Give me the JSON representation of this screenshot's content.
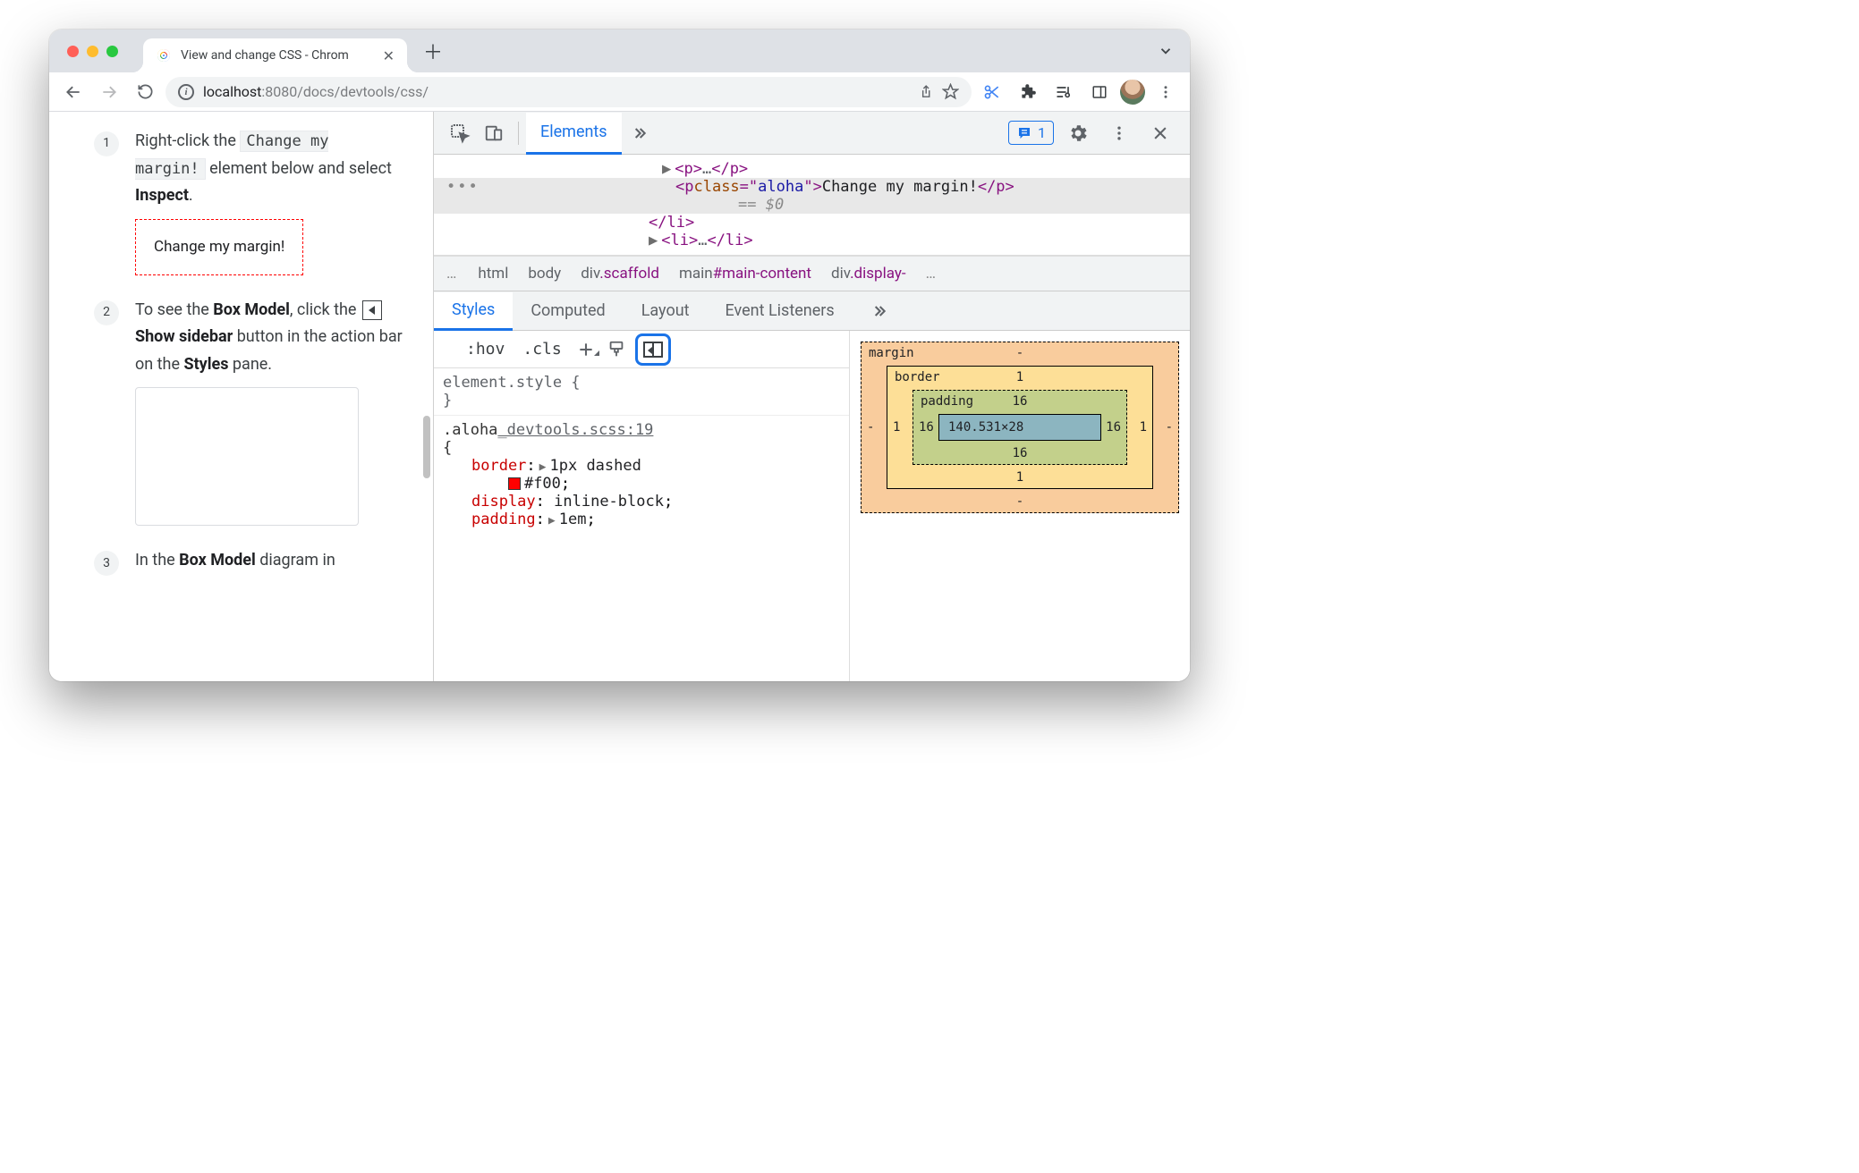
{
  "browser": {
    "tab_title": "View and change CSS - Chrom",
    "url_info_tooltip": "i",
    "url_host": "localhost",
    "url_port_path": ":8080/docs/devtools/css/"
  },
  "page": {
    "steps": [
      {
        "num": "1",
        "pre": "Right-click the ",
        "code": "Change my margin!",
        "mid": " element below and select ",
        "bold": "Inspect",
        "post": "."
      },
      {
        "num": "2",
        "pre": "To see the ",
        "bold1": "Box Model",
        "mid1": ", click the ",
        "bold2": "Show sidebar",
        "mid2": " button in the action bar on the ",
        "bold3": "Styles",
        "post": " pane."
      },
      {
        "num": "3",
        "pre": "In the ",
        "bold1": "Box Model",
        "post": " diagram in"
      }
    ],
    "demo_text": "Change my margin!"
  },
  "devtools": {
    "tabs": {
      "elements": "Elements"
    },
    "issues_count": "1",
    "dom": {
      "l1": {
        "open": "<p>",
        "mid": "…",
        "close": "</p>"
      },
      "l2": {
        "open": "<p ",
        "attr_n": "class",
        "eq": "=\"",
        "attr_v": "aloha",
        "endq": "\">",
        "text": "Change my margin!",
        "close": "</p>"
      },
      "l2eq": "== $0",
      "l3": "</li>",
      "l4": {
        "open": "<li>",
        "mid": "…",
        "close": "</li>"
      }
    },
    "crumbs": {
      "more": "…",
      "html": "html",
      "body": "body",
      "div1_tag": "div",
      "div1_cls": ".scaffold",
      "main_tag": "main",
      "main_id": "#main-content",
      "div2_tag": "div",
      "div2_cls": ".display-",
      "more2": "…"
    },
    "panes": {
      "styles": "Styles",
      "computed": "Computed",
      "layout": "Layout",
      "ev": "Event Listeners"
    },
    "styles_toolbar": {
      "hov": ":hov",
      "cls": ".cls"
    },
    "rules": {
      "elstyle_sel": "element.style {",
      "elstyle_close": "}",
      "aloha_sel": ".aloha",
      "aloha_src": "_devtools.scss:19",
      "open": "{",
      "border_n": "border",
      "border_v": "1px dashed",
      "border_color": "#f00",
      "display_n": "display",
      "display_v": "inline-block",
      "padding_n": "padding",
      "padding_v": "1em"
    },
    "boxmodel": {
      "margin_label": "margin",
      "margin_t": "-",
      "margin_r": "-",
      "margin_b": "-",
      "margin_l": "-",
      "border_label": "border",
      "border_t": "1",
      "border_r": "1",
      "border_b": "1",
      "border_l": "1",
      "padding_label": "padding",
      "padding_t": "16",
      "padding_r": "16",
      "padding_b": "16",
      "padding_l": "16",
      "content": "140.531×28"
    }
  }
}
